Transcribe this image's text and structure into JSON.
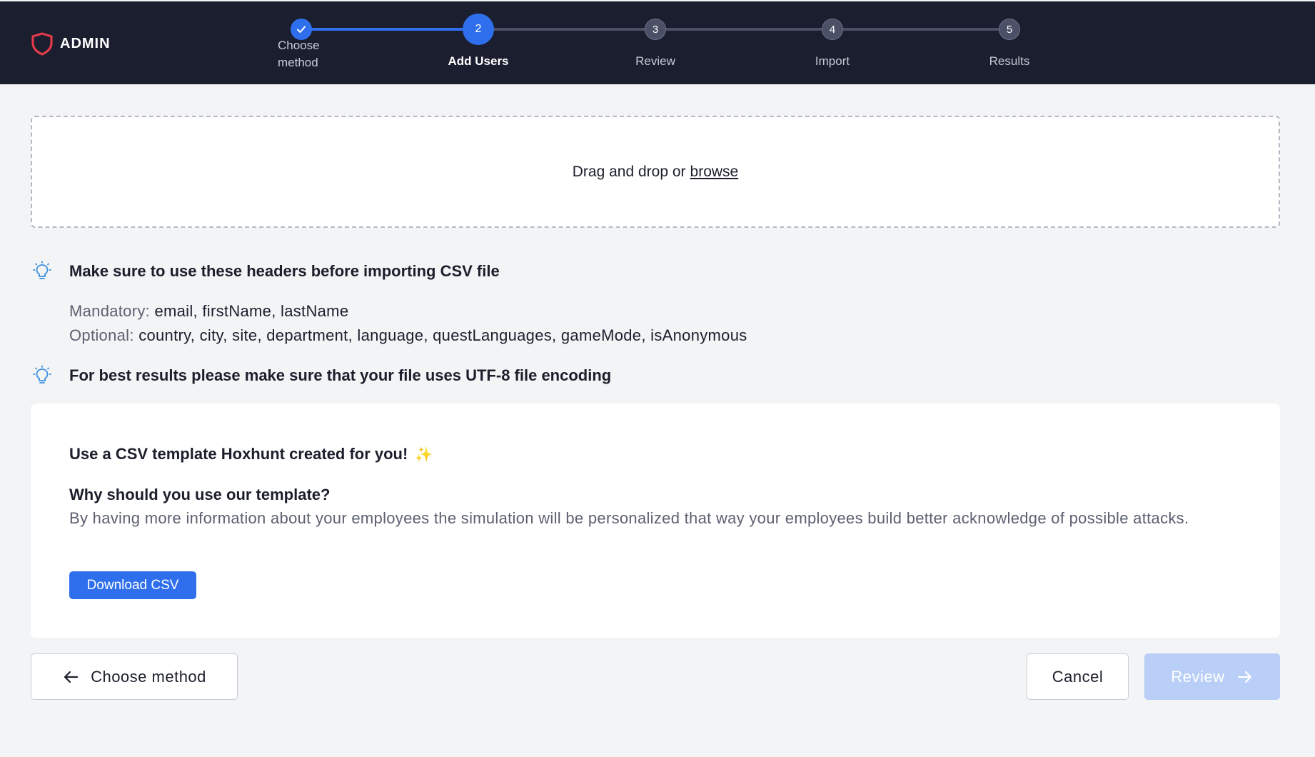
{
  "brand": {
    "name": "ADMIN",
    "logo_icon": "shield-icon",
    "accent": "#e23b4a"
  },
  "stepper": {
    "steps": [
      {
        "number": "1",
        "label": "Choose method",
        "state": "done"
      },
      {
        "number": "2",
        "label": "Add Users",
        "state": "active"
      },
      {
        "number": "3",
        "label": "Review",
        "state": "todo"
      },
      {
        "number": "4",
        "label": "Import",
        "state": "todo"
      },
      {
        "number": "5",
        "label": "Results",
        "state": "todo"
      }
    ]
  },
  "dropzone": {
    "text": "Drag and drop or",
    "link": "browse"
  },
  "tips": {
    "headers_title": "Make sure to use these headers before importing CSV file",
    "mandatory_label": "Mandatory:",
    "mandatory_value": "email, firstName, lastName",
    "optional_label": "Optional:",
    "optional_value": "country, city, site, department, language, questLanguages, gameMode, isAnonymous",
    "encoding_title": "For best results please make sure that your file uses UTF-8 file encoding"
  },
  "template_card": {
    "title": "Use a CSV template Hoxhunt created for you!",
    "sparkle": "✨",
    "why_title": "Why should you use our template?",
    "why_text": "By having more information about your employees the simulation will be personalized that way your employees build better acknowledge of possible attacks.",
    "download_label": "Download CSV"
  },
  "footer": {
    "back_label": "Choose method",
    "cancel_label": "Cancel",
    "review_label": "Review"
  },
  "colors": {
    "primary": "#2f6fed",
    "topbar": "#1b1e2e",
    "disabled": "#b9cff8"
  }
}
